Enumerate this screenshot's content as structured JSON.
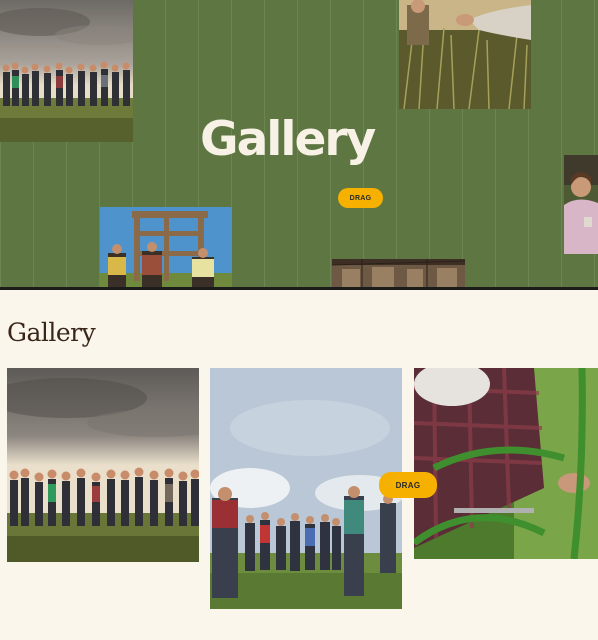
{
  "hero": {
    "title": "Gallery",
    "drag_label": "DRAG"
  },
  "section": {
    "title": "Gallery",
    "drag_label": "DRAG"
  },
  "colors": {
    "hero_background": "#5e7642",
    "page_background": "#fbf6ec",
    "drag_pill": "#f5b000",
    "section_title": "#3a2619"
  },
  "top_photos": [
    {
      "subject": "group-in-field-at-dusk"
    },
    {
      "subject": "hands-in-tall-grass"
    },
    {
      "subject": "wooden-structure-with-people"
    },
    {
      "subject": "barn-interior"
    },
    {
      "subject": "smiling-woman"
    }
  ],
  "bottom_photos": [
    {
      "subject": "group-in-field-at-dusk"
    },
    {
      "subject": "people-in-field-cloudy-sky"
    },
    {
      "subject": "person-pruning-plants"
    }
  ]
}
